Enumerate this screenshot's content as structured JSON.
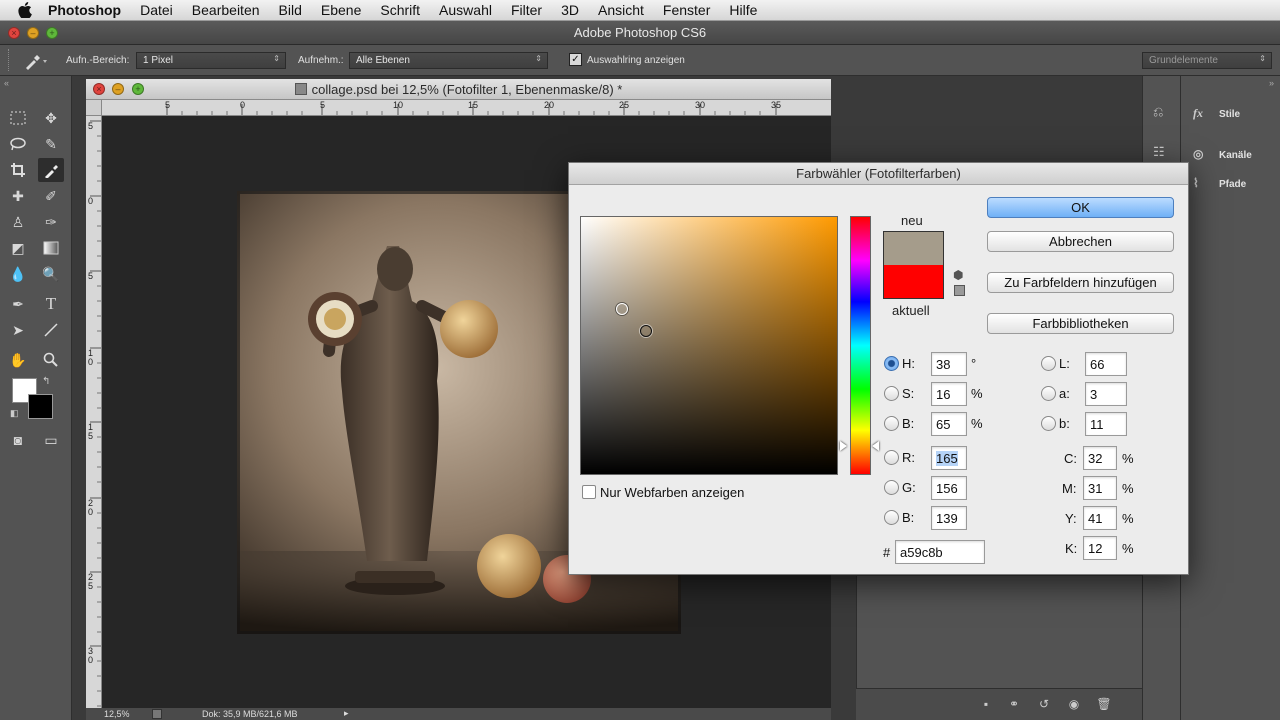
{
  "menubar": {
    "app": "Photoshop",
    "items": [
      "Datei",
      "Bearbeiten",
      "Bild",
      "Ebene",
      "Schrift",
      "Auswahl",
      "Filter",
      "3D",
      "Ansicht",
      "Fenster",
      "Hilfe"
    ]
  },
  "window": {
    "title": "Adobe Photoshop CS6"
  },
  "options": {
    "sample_size_label": "Aufn.-Bereich:",
    "sample_size_value": "1 Pixel",
    "sample_label": "Aufnehm.:",
    "sample_value": "Alle Ebenen",
    "show_ring_label": "Auswahlring anzeigen",
    "show_ring_checked": true,
    "workspace_value": "Grundelemente"
  },
  "document": {
    "title": "collage.psd bei 12,5% (Fotofilter 1, Ebenenmaske/8) *",
    "ruler_h_labels": [
      "5",
      "0",
      "5",
      "10",
      "15",
      "20",
      "25",
      "30",
      "35"
    ],
    "ruler_v_labels": [
      "5",
      "0",
      "5",
      "1\n0",
      "1\n5",
      "2\n0",
      "2\n5",
      "3\n0"
    ],
    "zoom": "12,5%",
    "doc_size": "Dok: 35,9 MB/621,6 MB"
  },
  "panels": {
    "items": [
      {
        "label": "Stile",
        "icon": "styles-icon"
      },
      {
        "label": "Kanäle",
        "icon": "channels-icon"
      },
      {
        "label": "Pfade",
        "icon": "paths-icon"
      }
    ]
  },
  "dialog": {
    "title": "Farbwähler (Fotofilterfarben)",
    "new_label": "neu",
    "current_label": "aktuell",
    "new_color": "#a59c8b",
    "current_color": "#ff0000",
    "buttons": {
      "ok": "OK",
      "cancel": "Abbrechen",
      "add_swatches": "Zu Farbfeldern hinzufügen",
      "libraries": "Farbbibliotheken"
    },
    "web_only_label": "Nur Webfarben anzeigen",
    "fields": {
      "H": {
        "label": "H:",
        "value": "38",
        "unit": "°"
      },
      "S": {
        "label": "S:",
        "value": "16",
        "unit": "%"
      },
      "Bv": {
        "label": "B:",
        "value": "65",
        "unit": "%"
      },
      "R": {
        "label": "R:",
        "value": "165"
      },
      "G": {
        "label": "G:",
        "value": "156"
      },
      "Bc": {
        "label": "B:",
        "value": "139"
      },
      "L": {
        "label": "L:",
        "value": "66"
      },
      "a": {
        "label": "a:",
        "value": "3"
      },
      "b": {
        "label": "b:",
        "value": "11"
      },
      "C": {
        "label": "C:",
        "value": "32",
        "unit": "%"
      },
      "M": {
        "label": "M:",
        "value": "31",
        "unit": "%"
      },
      "Y": {
        "label": "Y:",
        "value": "41",
        "unit": "%"
      },
      "K": {
        "label": "K:",
        "value": "12",
        "unit": "%"
      }
    },
    "hash": "#",
    "hex": "a59c8b",
    "selected_mode": "H"
  },
  "colors": {
    "hue_base": "#ff9a00",
    "foreground": "#ffffff",
    "background": "#000000"
  }
}
